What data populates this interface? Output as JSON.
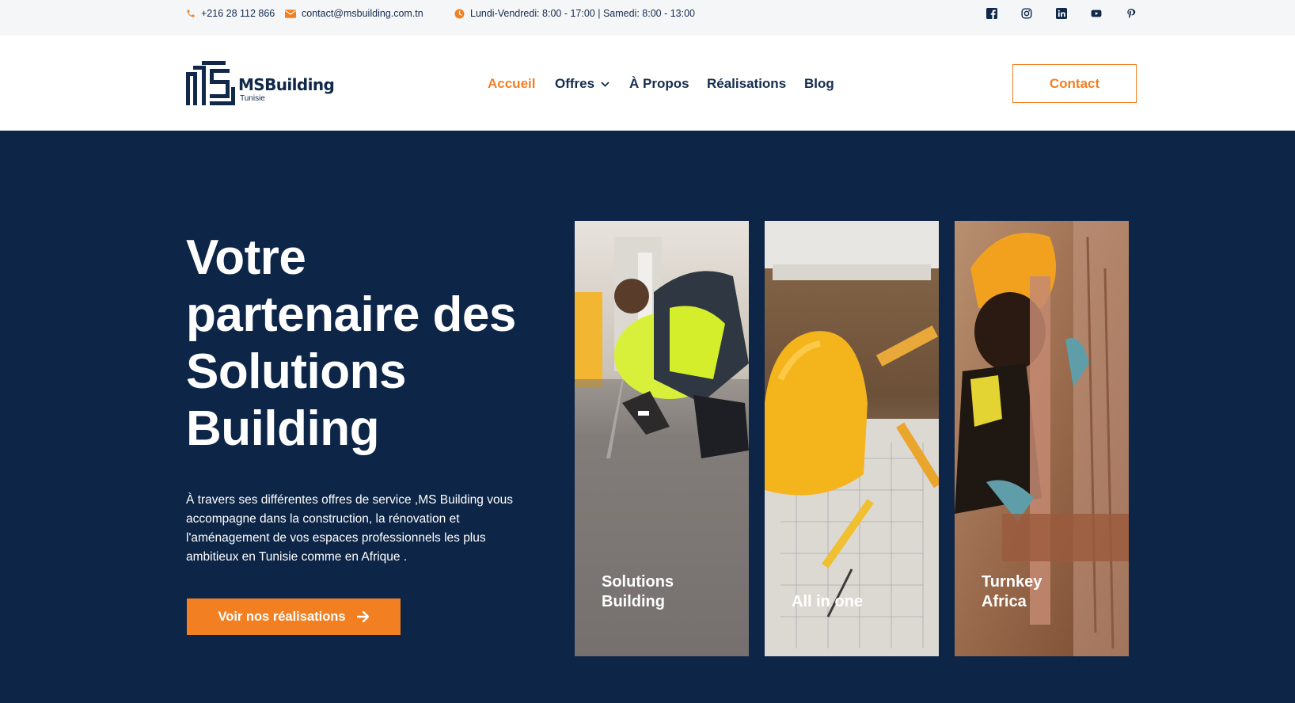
{
  "topbar": {
    "phone": "+216 28 112 866",
    "email": "contact@msbuilding.com.tn",
    "hours": "Lundi-Vendredi: 8:00 - 17:00 | Samedi: 8:00 - 13:00",
    "icons": [
      "phone-icon",
      "envelope-icon",
      "clock-icon"
    ],
    "social": [
      "facebook-icon",
      "instagram-icon",
      "linkedin-icon",
      "youtube-icon",
      "pinterest-icon"
    ]
  },
  "brand": {
    "name": "MSBuilding",
    "sub": "Tunisie"
  },
  "nav": {
    "items": [
      {
        "label": "Accueil",
        "active": true
      },
      {
        "label": "Offres",
        "dropdown": true
      },
      {
        "label": "À Propos"
      },
      {
        "label": "Réalisations"
      },
      {
        "label": "Blog"
      }
    ],
    "contact_label": "Contact"
  },
  "hero": {
    "title": "Votre partenaire des Solutions Building",
    "text": "À travers ses différentes offres de service ,MS Building vous accompagne dans la construction, la rénovation et l'aménagement de vos espaces professionnels les plus ambitieux en Tunisie comme en Afrique .",
    "cta_label": "Voir nos réalisations"
  },
  "cards": [
    {
      "label": "Solutions\nBuilding"
    },
    {
      "label": "All in one"
    },
    {
      "label": "Turnkey\nAfrica"
    }
  ],
  "colors": {
    "accent": "#f28023",
    "navy": "#0d2547",
    "text_dark": "#152c4e"
  }
}
